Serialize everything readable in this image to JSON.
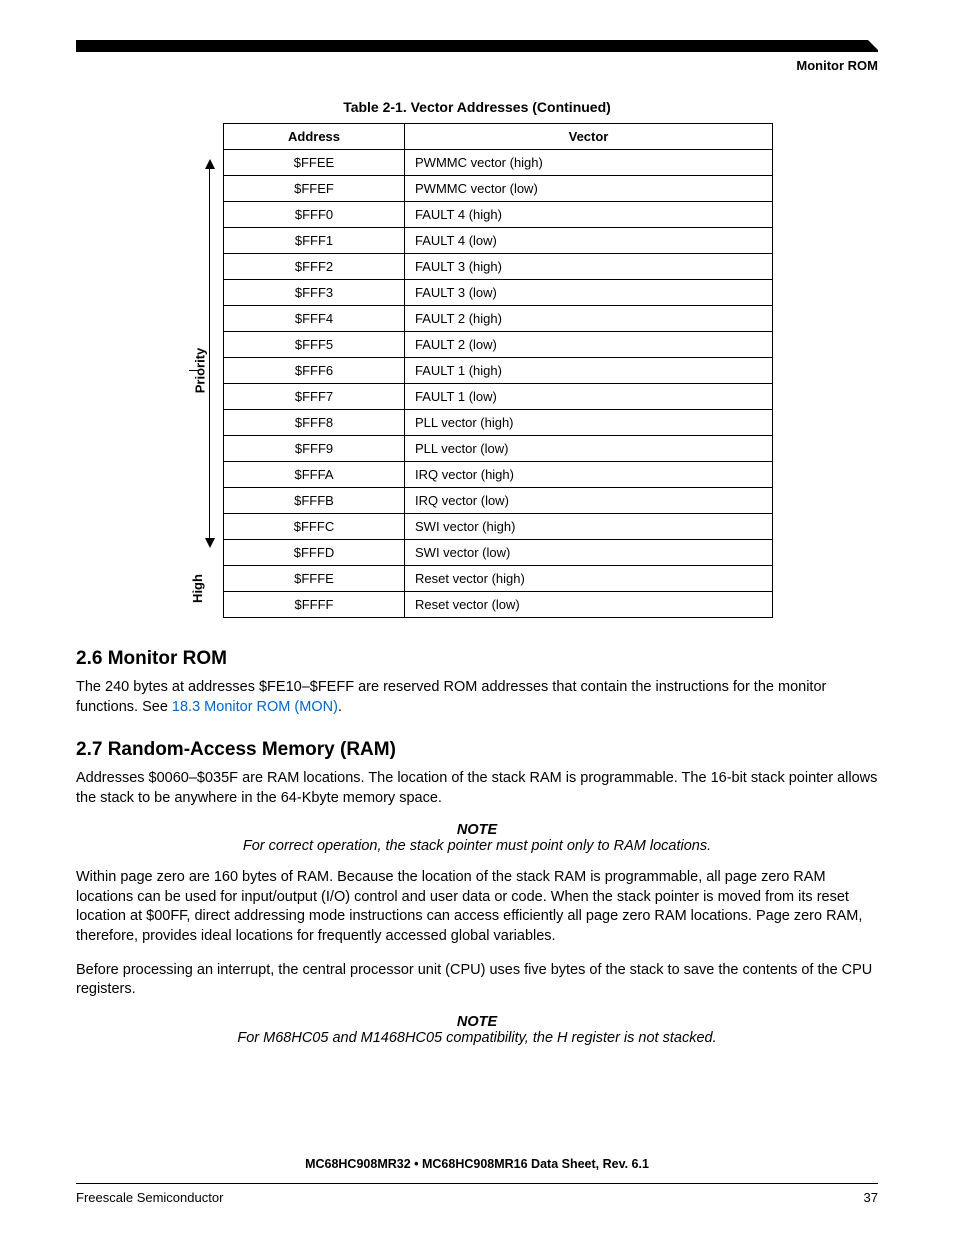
{
  "header": {
    "section_label": "Monitor ROM",
    "table_caption": "Table 2-1. Vector Addresses (Continued)"
  },
  "arrow": {
    "priority": "Priority",
    "high": "High"
  },
  "table": {
    "col_address": "Address",
    "col_vector": "Vector",
    "rows": [
      {
        "addr": "$FFEE",
        "vec": "PWMMC vector (high)"
      },
      {
        "addr": "$FFEF",
        "vec": "PWMMC vector (low)"
      },
      {
        "addr": "$FFF0",
        "vec": "FAULT 4 (high)"
      },
      {
        "addr": "$FFF1",
        "vec": "FAULT 4 (low)"
      },
      {
        "addr": "$FFF2",
        "vec": "FAULT 3 (high)"
      },
      {
        "addr": "$FFF3",
        "vec": "FAULT 3 (low)"
      },
      {
        "addr": "$FFF4",
        "vec": "FAULT 2 (high)"
      },
      {
        "addr": "$FFF5",
        "vec": "FAULT 2 (low)"
      },
      {
        "addr": "$FFF6",
        "vec": "FAULT 1 (high)"
      },
      {
        "addr": "$FFF7",
        "vec": "FAULT 1 (low)"
      },
      {
        "addr": "$FFF8",
        "vec": "PLL vector (high)"
      },
      {
        "addr": "$FFF9",
        "vec": "PLL vector (low)"
      },
      {
        "addr": "$FFFA",
        "vec": "IRQ vector (high)"
      },
      {
        "addr": "$FFFB",
        "vec": "IRQ vector (low)"
      },
      {
        "addr": "$FFFC",
        "vec": "SWI vector (high)"
      },
      {
        "addr": "$FFFD",
        "vec": "SWI vector (low)"
      },
      {
        "addr": "$FFFE",
        "vec": "Reset vector (high)"
      },
      {
        "addr": "$FFFF",
        "vec": "Reset vector (low)"
      }
    ]
  },
  "sections": {
    "s26_heading": "2.6  Monitor ROM",
    "s26_body_a": "The 240 bytes at addresses $FE10–$FEFF are reserved ROM addresses that contain the instructions for the monitor functions. See ",
    "s26_link": "18.3 Monitor ROM (MON)",
    "s26_body_b": ".",
    "s27_heading": "2.7  Random-Access Memory (RAM)",
    "s27_p1": "Addresses $0060–$035F are RAM locations. The location of the stack RAM is programmable. The 16-bit stack pointer allows the stack to be anywhere in the 64-Kbyte memory space.",
    "s27_note1_h": "NOTE",
    "s27_note1_b": "For correct operation, the stack pointer must point only to RAM locations.",
    "s27_p2": "Within page zero are 160 bytes of RAM. Because the location of the stack RAM is programmable, all page zero RAM locations can be used for input/output (I/O) control and user data or code. When the stack pointer is moved from its reset location at $00FF, direct addressing mode instructions can access efficiently all page zero RAM locations. Page zero RAM, therefore, provides ideal locations for frequently accessed global variables.",
    "s27_p3": "Before processing an interrupt, the central processor unit (CPU) uses five bytes of the stack to save the contents of the CPU registers.",
    "s27_note2_h": "NOTE",
    "s27_note2_b": "For M68HC05 and M1468HC05 compatibility, the H register is not stacked."
  },
  "footer": {
    "doc_title": "MC68HC908MR32 • MC68HC908MR16 Data Sheet, Rev. 6.1",
    "company": "Freescale Semiconductor",
    "page": "37"
  }
}
